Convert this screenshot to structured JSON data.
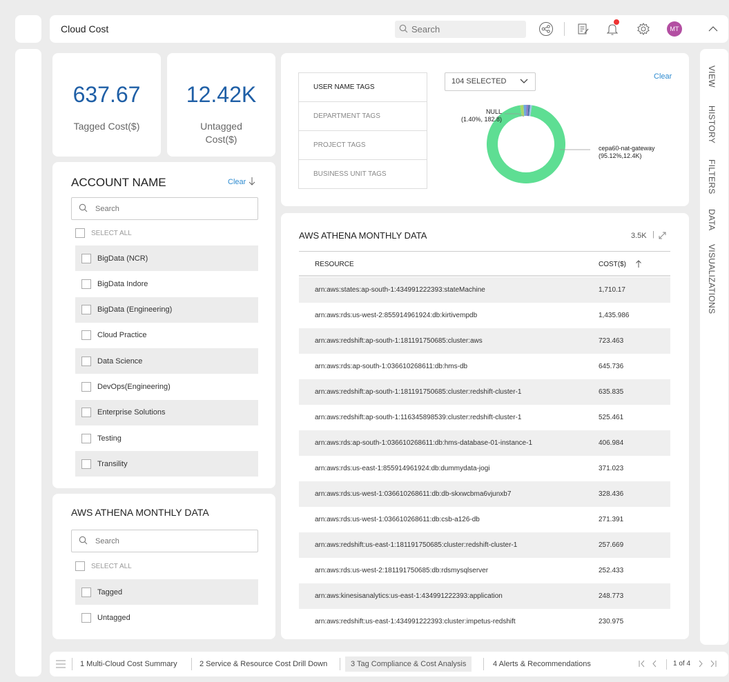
{
  "header": {
    "title": "Cloud Cost",
    "search_placeholder": "Search",
    "avatar_initials": "MT",
    "icons": [
      "share-icon",
      "edit-notes-icon",
      "bell-icon",
      "gear-icon",
      "chevron-up-icon"
    ]
  },
  "kpis": {
    "tagged": {
      "value": "637.67",
      "label": "Tagged Cost($)"
    },
    "untagged": {
      "value": "12.42K",
      "label": "Untagged Cost($)"
    }
  },
  "account_filter": {
    "title": "ACCOUNT NAME",
    "clear_label": "Clear",
    "search_placeholder": "Search",
    "select_all_label": "SELECT ALL",
    "options": [
      "BigData (NCR)",
      "BigData Indore",
      "BigData (Engineering)",
      "Cloud Practice",
      "Data Science",
      "DevOps(Engineering)",
      "Enterprise Solutions",
      "Testing",
      "Transility"
    ]
  },
  "athena_filter": {
    "title": "AWS ATHENA MONTHLY DATA",
    "search_placeholder": "Search",
    "select_all_label": "SELECT ALL",
    "options": [
      "Tagged",
      "Untagged"
    ]
  },
  "tags": {
    "items": [
      "USER NAME TAGS",
      "DEPARTMENT TAGS",
      "PROJECT TAGS",
      "BUSINESS UNIT TAGS"
    ],
    "active_index": 0,
    "dropdown_value": "104 SELECTED",
    "clear_label": "Clear"
  },
  "chart_data": {
    "type": "pie",
    "donut": true,
    "slices": [
      {
        "label": "cepa60-nat-gateway",
        "percent": 95.12,
        "value_text": "12.4K",
        "color": "#5ede93"
      },
      {
        "label": "NULL",
        "percent": 1.4,
        "value_text": "182.8",
        "color": "#a8d66b"
      },
      {
        "label": "",
        "percent": 1.2,
        "color": "#6fa8dc"
      },
      {
        "label": "",
        "percent": 0.8,
        "color": "#8e7cc3"
      },
      {
        "label": "",
        "percent": 0.7,
        "color": "#4a6fa5"
      },
      {
        "label": "",
        "percent": 0.78,
        "color": "#9fc5e8"
      }
    ],
    "labels": {
      "main": {
        "name": "cepa60-nat-gateway",
        "detail": "(95.12%,12.4K)"
      },
      "null": {
        "name": "NULL",
        "detail": "(1.40%, 182.8)"
      }
    }
  },
  "table": {
    "title": "AWS ATHENA MONTHLY DATA",
    "count": "3.5K",
    "count_separator": "|",
    "columns": [
      "RESOURCE",
      "COST($)"
    ],
    "rows": [
      [
        "arn:aws:states:ap-south-1:434991222393:stateMachine",
        "1,710.17"
      ],
      [
        "arn:aws:rds:us-west-2:855914961924:db:kirtivempdb",
        "1,435.986"
      ],
      [
        "arn:aws:redshift:ap-south-1:181191750685:cluster:aws",
        "723.463"
      ],
      [
        "arn:aws:rds:ap-south-1:036610268611:db:hms-db",
        "645.736"
      ],
      [
        "arn:aws:redshift:ap-south-1:181191750685:cluster:redshift-cluster-1",
        "635.835"
      ],
      [
        "arn:aws:redshift:ap-south-1:116345898539:cluster:redshift-cluster-1",
        "525.461"
      ],
      [
        "arn:aws:rds:ap-south-1:036610268611:db:hms-database-01-instance-1",
        "406.984"
      ],
      [
        "arn:aws:rds:us-east-1:855914961924:db:dummydata-jogi",
        "371.023"
      ],
      [
        "arn:aws:rds:us-west-1:036610268611:db:db-skxwcbma6vjunxb7",
        "328.436"
      ],
      [
        "arn:aws:rds:us-west-1:036610268611:db:csb-a126-db",
        "271.391"
      ],
      [
        "arn:aws:redshift:us-east-1:181191750685:cluster:redshift-cluster-1",
        "257.669"
      ],
      [
        "arn:aws:rds:us-west-2:181191750685:db:rdsmysqlserver",
        "252.433"
      ],
      [
        "arn:aws:kinesisanalytics:us-east-1:434991222393:application",
        "248.773"
      ],
      [
        "arn:aws:redshift:us-east-1:434991222393:cluster:impetus-redshift",
        "230.975"
      ]
    ]
  },
  "side_tabs": [
    "VIEW",
    "HISTORY",
    "FILTERS",
    "DATA",
    "VISUALIZATIONS"
  ],
  "footer": {
    "tabs": [
      "1 Multi-Cloud Cost Summary",
      "2 Service & Resource Cost Drill Down",
      "3 Tag Compliance & Cost Analysis",
      "4 Alerts & Recommendations"
    ],
    "active_index": 2,
    "pager_text": "1 of 4"
  },
  "colors": {
    "accent": "#1f5fa6",
    "link": "#2e8bd0",
    "avatar": "#b34fa2",
    "donut_main": "#5ede93"
  }
}
